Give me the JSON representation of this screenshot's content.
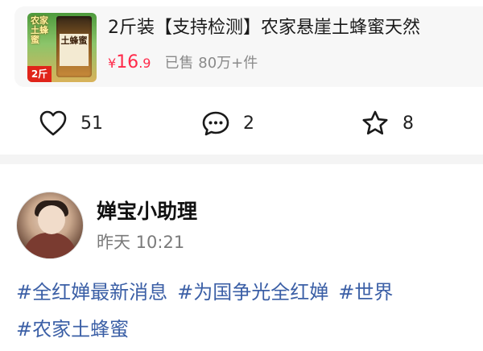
{
  "product": {
    "thumb_title": "农家土蜂蜜",
    "thumb_jar_label": "土蜂蜜",
    "thumb_badge": "2斤",
    "title": "2斤装【支持检测】农家悬崖土蜂蜜天然",
    "price_symbol": "¥",
    "price_integer": "16",
    "price_decimal": ".9",
    "sold": "已售 80万+件"
  },
  "actions": {
    "like_count": "51",
    "comment_count": "2",
    "share_count": "8",
    "icons": [
      "heart-icon",
      "comment-icon",
      "star-icon"
    ]
  },
  "post": {
    "username": "婵宝小助理",
    "time": "昨天 10:21",
    "tags_line1": [
      "#全红婵最新消息",
      "#为国争光全红婵",
      "#世界"
    ],
    "tags_line2": [
      "#农家土蜂蜜"
    ]
  },
  "colors": {
    "price": "#ff2a4a",
    "tag_link": "#3b5fa6",
    "muted": "#7a7a7a"
  }
}
